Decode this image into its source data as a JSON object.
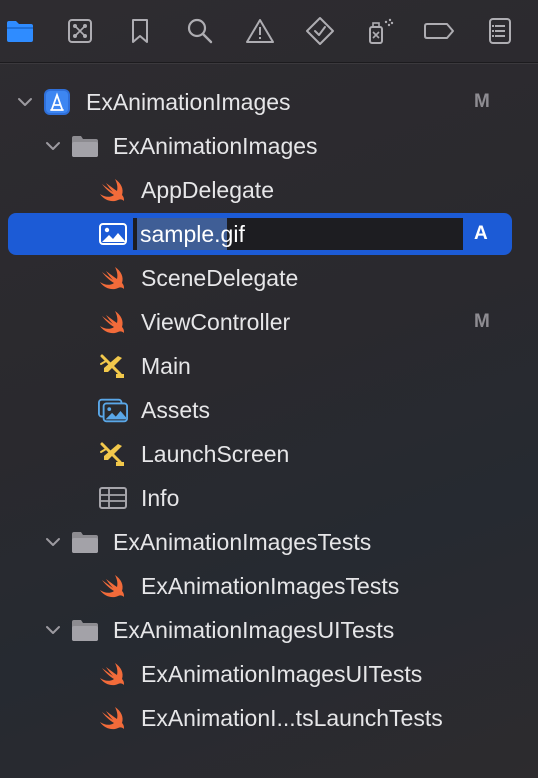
{
  "toolbar": {
    "icons": [
      {
        "name": "folder-icon",
        "active": true
      },
      {
        "name": "source-control-icon"
      },
      {
        "name": "bookmark-icon"
      },
      {
        "name": "search-icon"
      },
      {
        "name": "warning-icon"
      },
      {
        "name": "test-diamond-icon"
      },
      {
        "name": "debug-spray-icon"
      },
      {
        "name": "breakpoint-icon"
      },
      {
        "name": "report-icon"
      }
    ],
    "active_color": "#2f8cff",
    "icon_color": "#aeadb2"
  },
  "tree": {
    "project": {
      "label": "ExAnimationImages",
      "badge": "M"
    },
    "group_main": {
      "label": "ExAnimationImages"
    },
    "files": {
      "app_delegate": {
        "label": "AppDelegate"
      },
      "sample_gif": {
        "name_part": "sample",
        "ext_part": ".gif",
        "badge": "A"
      },
      "scene_delegate": {
        "label": "SceneDelegate"
      },
      "view_controller": {
        "label": "ViewController",
        "badge": "M"
      },
      "main": {
        "label": "Main"
      },
      "assets": {
        "label": "Assets"
      },
      "launch_screen": {
        "label": "LaunchScreen"
      },
      "info": {
        "label": "Info"
      }
    },
    "group_tests": {
      "label": "ExAnimationImagesTests"
    },
    "tests_file": {
      "label": "ExAnimationImagesTests"
    },
    "group_ui_tests": {
      "label": "ExAnimationImagesUITests"
    },
    "ui_tests_file": {
      "label": "ExAnimationImagesUITests"
    },
    "launch_tests_file": {
      "label": "ExAnimationI...tsLaunchTests"
    }
  }
}
